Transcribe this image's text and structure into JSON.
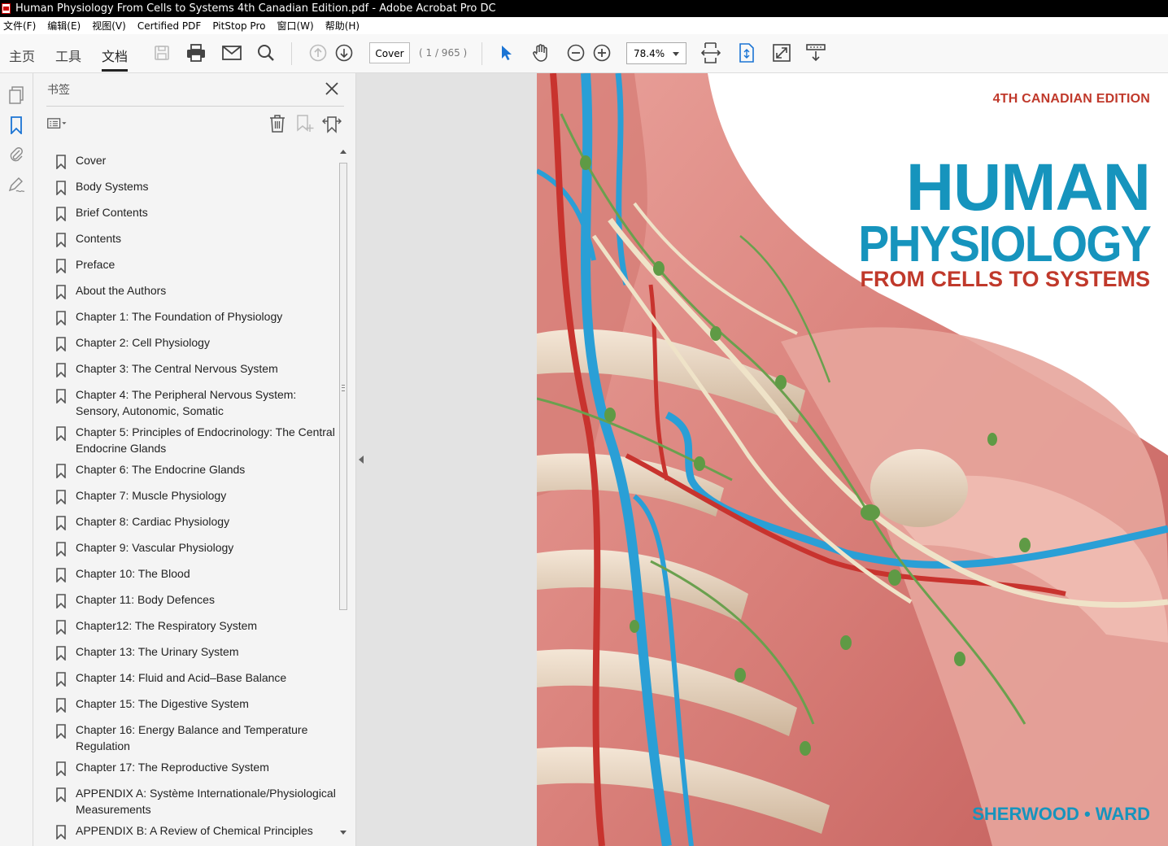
{
  "window": {
    "title": "Human Physiology From Cells to Systems 4th Canadian Edition.pdf - Adobe Acrobat Pro DC"
  },
  "menu": [
    "文件(F)",
    "编辑(E)",
    "视图(V)",
    "Certified PDF",
    "PitStop Pro",
    "窗口(W)",
    "帮助(H)"
  ],
  "toolbar": {
    "tabs": [
      "主页",
      "工具",
      "文档"
    ],
    "active_tab": "文档",
    "page_input": "Cover",
    "page_count": "( 1 / 965 )",
    "zoom": "78.4%",
    "icons": [
      "save-icon",
      "print-icon",
      "email-icon",
      "search-icon",
      "page-up-icon",
      "page-down-icon",
      "select-cursor-icon",
      "hand-icon",
      "zoom-out-icon",
      "zoom-in-icon",
      "fit-width-icon",
      "fit-page-icon",
      "fullscreen-icon",
      "read-mode-icon"
    ]
  },
  "rail": {
    "icons": [
      "pages-icon",
      "bookmark-icon",
      "attachment-icon",
      "signature-icon"
    ]
  },
  "bookmarks_panel": {
    "title": "书签",
    "items": [
      "Cover",
      "Body Systems",
      "Brief Contents",
      "Contents",
      "Preface",
      "About the Authors",
      "Chapter 1: The Foundation of Physiology",
      "Chapter 2: Cell Physiology",
      "Chapter 3: The Central Nervous System",
      "Chapter 4: The Peripheral Nervous System: Sensory, Autonomic, Somatic",
      "Chapter 5: Principles of Endocrinology: The Central Endocrine Glands",
      "Chapter 6: The Endocrine Glands",
      "Chapter 7: Muscle Physiology",
      "Chapter 8: Cardiac Physiology",
      "Chapter 9: Vascular Physiology",
      "Chapter 10: The Blood",
      "Chapter 11: Body Defences",
      "Chapter12: The Respiratory System",
      "Chapter 13: The Urinary System",
      "Chapter 14: Fluid and Acid–Base Balance",
      "Chapter 15: The Digestive System",
      "Chapter 16: Energy Balance and Temperature Regulation",
      "Chapter 17: The Reproductive System",
      "APPENDIX A: Système Internationale/Physiological Measurements",
      "APPENDIX B: A Review of Chemical Principles"
    ]
  },
  "cover": {
    "edition": "4TH CANADIAN EDITION",
    "title_line1": "HUMAN",
    "title_line2": "PHYSIOLOGY",
    "subtitle": "FROM CELLS TO SYSTEMS",
    "authors": "SHERWOOD • WARD"
  }
}
